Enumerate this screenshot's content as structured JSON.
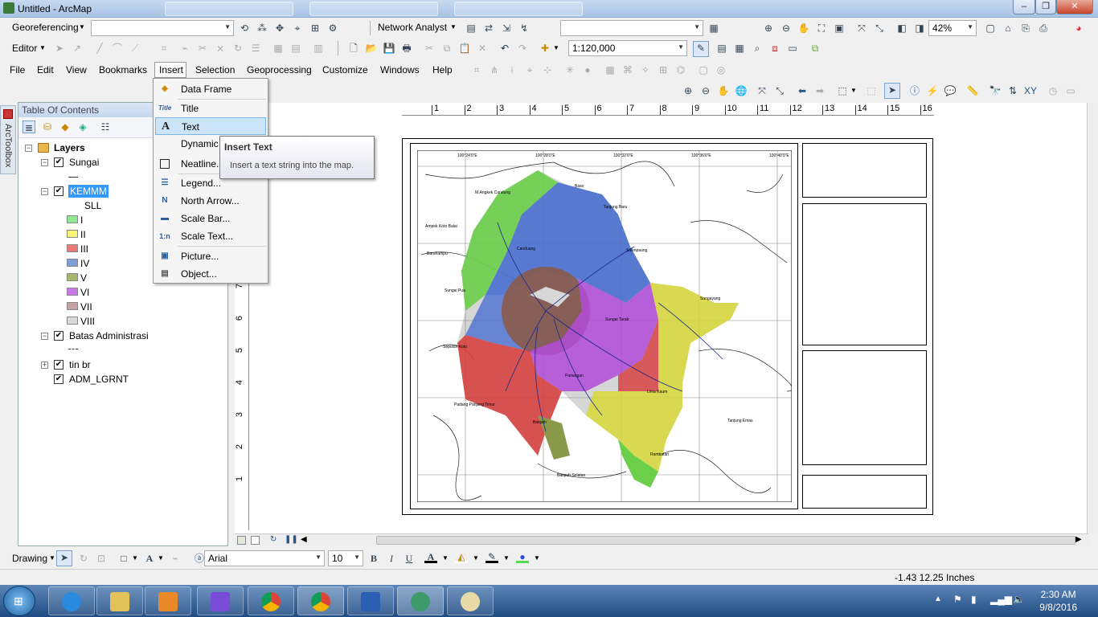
{
  "window": {
    "title": "Untitled - ArcMap",
    "minimize": "–",
    "maximize": "❐",
    "close": "✕"
  },
  "toolbar1": {
    "georeferencing": "Georeferencing",
    "network_analyst": "Network Analyst",
    "zoom": "42%"
  },
  "toolbar2": {
    "editor": "Editor",
    "scale": "1:120,000"
  },
  "menu": {
    "file": "File",
    "edit": "Edit",
    "view": "View",
    "bookmarks": "Bookmarks",
    "insert": "Insert",
    "selection": "Selection",
    "geoprocessing": "Geoprocessing",
    "customize": "Customize",
    "windows": "Windows",
    "help": "Help"
  },
  "arctoolbox": "ArcToolbox",
  "toc": {
    "title": "Table Of Contents",
    "layers": "Layers",
    "sungai": "Sungai",
    "kemmm": "KEMMM",
    "sll": "SLL",
    "classes": [
      {
        "label": "I",
        "color": "#8fe88f"
      },
      {
        "label": "II",
        "color": "#f5f57a"
      },
      {
        "label": "III",
        "color": "#e87a7a"
      },
      {
        "label": "IV",
        "color": "#7f9fd8"
      },
      {
        "label": "V",
        "color": "#a8b86a"
      },
      {
        "label": "VI",
        "color": "#c77ae8"
      },
      {
        "label": "VII",
        "color": "#c6a3a3"
      },
      {
        "label": "VIII",
        "color": "#d9d9d9"
      }
    ],
    "batas": "Batas Administrasi",
    "tin": "tin br",
    "adm": "ADM_LGRNT"
  },
  "insert_menu": {
    "data_frame": "Data Frame",
    "title": "Title",
    "text": "Text",
    "dynamic": "Dynamic",
    "neatline": "Neatline...",
    "legend": "Legend...",
    "north_arrow": "North Arrow...",
    "scale_bar": "Scale Bar...",
    "scale_text": "Scale Text...",
    "picture": "Picture...",
    "object": "Object..."
  },
  "tooltip": {
    "title": "Insert Text",
    "body": "Insert a text string into the map."
  },
  "ruler": {
    "h": [
      "1",
      "2",
      "3",
      "4",
      "5",
      "6",
      "7",
      "8",
      "9",
      "10",
      "11",
      "12",
      "13",
      "14",
      "15",
      "16"
    ],
    "v": [
      "7",
      "6",
      "5",
      "4",
      "3",
      "2",
      "1"
    ]
  },
  "map": {
    "top_coords": [
      "100°24'0\"E",
      "100°28'0\"E",
      "100°32'0\"E",
      "100°36'0\"E",
      "100°40'0\"E"
    ],
    "bottom_coords": [
      "100°24'0\"E",
      "100°28'0\"E",
      "100°32'0\"E",
      "100°36'0\"E",
      "100°40'0\"E"
    ],
    "places": [
      "M.Angkek Candung",
      "Baso",
      "Tanjung Baru",
      "Ampek Koto Balai",
      "Canduang",
      "Salimpaung",
      "Baruhampu",
      "Sungai Pua",
      "Sungayang",
      "Sungai Tarab",
      "Sepuluh Koto",
      "Pariangan",
      "Lima Kaum",
      "Padang Panjang Timur",
      "Batipuh",
      "Tanjung Emas",
      "Rambatan",
      "Batipuh Selatan"
    ]
  },
  "drawing": {
    "label": "Drawing",
    "font": "Arial",
    "size": "10",
    "bold": "B",
    "italic": "I",
    "underline": "U"
  },
  "status": {
    "coords": "-1.43  12.25 Inches"
  },
  "clock": {
    "time": "2:30 AM",
    "date": "9/8/2016"
  }
}
